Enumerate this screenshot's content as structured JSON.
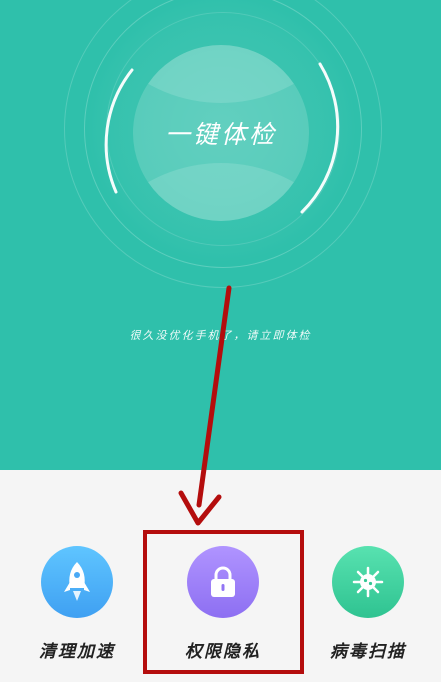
{
  "hero": {
    "main_button_label": "一键体检",
    "tip_text": "很久没优化手机了，请立即体检"
  },
  "tools": [
    {
      "label": "清理加速",
      "icon": "rocket-icon"
    },
    {
      "label": "权限隐私",
      "icon": "lock-icon"
    },
    {
      "label": "病毒扫描",
      "icon": "virus-icon"
    }
  ],
  "colors": {
    "hero_background": "#2fc0ab",
    "tool_clean": "#4fb2f8",
    "tool_privacy": "#9e80fa",
    "tool_virus": "#43d3a0",
    "annotation": "#b40d0d"
  }
}
